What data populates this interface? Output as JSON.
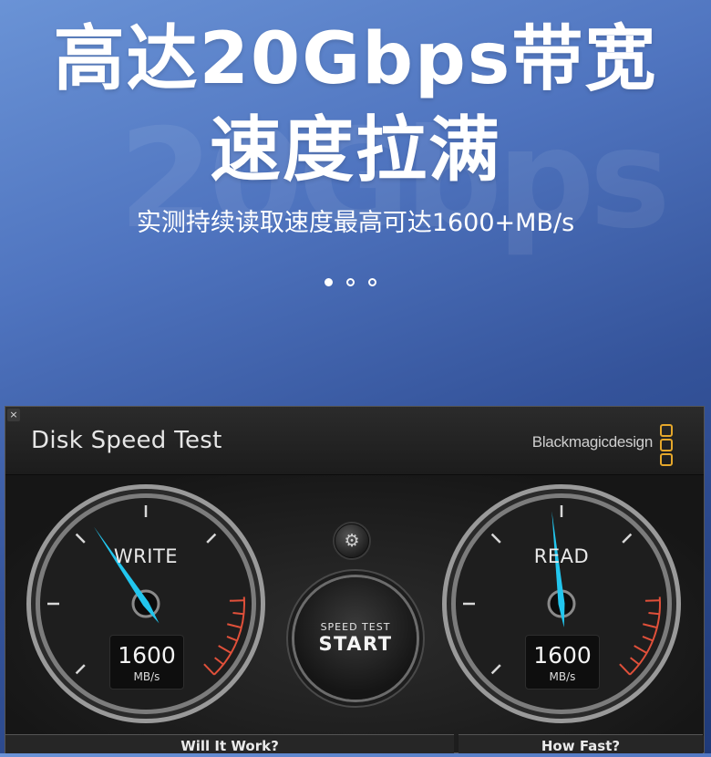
{
  "hero": {
    "title_line1": "高达20Gbps带宽",
    "title_line2": "速度拉满",
    "subtitle": "实测持续读取速度最高可达1600+MB/s",
    "watermark": "20Gbps",
    "carousel": {
      "count": 3,
      "active_index": 0
    }
  },
  "app": {
    "close_label": "×",
    "title": "Disk Speed Test",
    "brand": "Blackmagicdesign",
    "settings_icon": "gear-icon",
    "start_small": "SPEED TEST",
    "start_big": "START",
    "write": {
      "label": "WRITE",
      "value": "1600",
      "unit": "MB/s"
    },
    "read": {
      "label": "READ",
      "value": "1600",
      "unit": "MB/s"
    },
    "tabs": [
      "Will It Work?",
      "How Fast?"
    ],
    "colors": {
      "needle": "#22c6ee",
      "redline": "#e0503a",
      "brand_logo": "#e5a72b"
    }
  }
}
